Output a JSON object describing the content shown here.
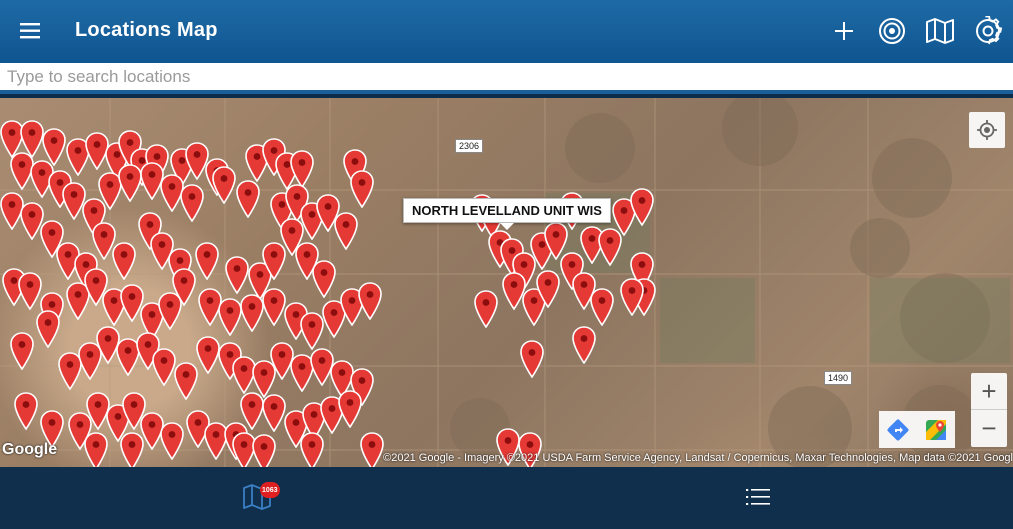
{
  "app": {
    "title": "Locations Map",
    "menu_icon": "hamburger-menu-icon",
    "actions": [
      {
        "name": "add-button",
        "icon": "plus-icon"
      },
      {
        "name": "target-button",
        "icon": "target-icon"
      },
      {
        "name": "map-button",
        "icon": "map-icon"
      },
      {
        "name": "settings-button",
        "icon": "gear-icon"
      }
    ]
  },
  "search": {
    "placeholder": "Type to search locations",
    "value": ""
  },
  "map": {
    "callout": "NORTH LEVELLAND UNIT WIS",
    "road_labels": [
      "2306",
      "1490"
    ],
    "google_logo": "Google",
    "attribution": "©2021 Google - Imagery ©2021 USDA Farm Service Agency, Landsat / Copernicus, Maxar Technologies, Map data ©2021 Googl",
    "zoom_in": "+",
    "zoom_out": "−",
    "pin_color": "#e53935"
  },
  "bottom_nav": {
    "map_tab_icon": "map-icon",
    "map_badge": "1063",
    "list_tab_icon": "list-icon"
  },
  "colors": {
    "appbar": "#1e6aa6",
    "bottom_bar": "#0f2f4c",
    "accent_blue": "#1a5f99"
  }
}
